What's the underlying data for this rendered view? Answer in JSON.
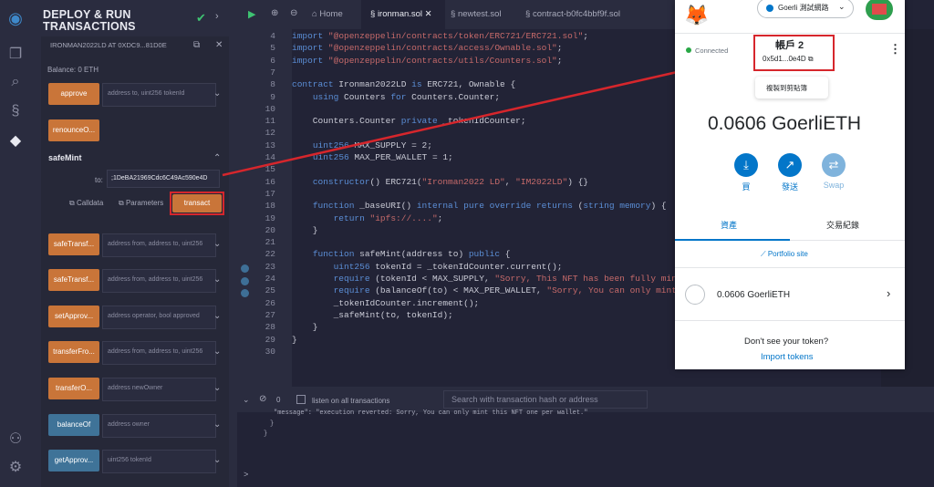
{
  "sidebar_icons": [
    "remix-logo-icon",
    "file-explorer-icon",
    "search-icon",
    "solidity-compiler-icon",
    "deploy-run-icon",
    "plugin-icon",
    "settings-icon"
  ],
  "panel": {
    "title": "DEPLOY & RUN TRANSACTIONS",
    "contract_instance": "IRONMAN2022LD AT 0XDC9...81D0E",
    "balance": "Balance: 0 ETH",
    "functions": [
      {
        "label": "approve",
        "placeholder": "address to, uint256 tokenId",
        "color": "orange"
      },
      {
        "label": "renounceO...",
        "placeholder": "",
        "color": "orange"
      },
      {
        "label": "safeTransf...",
        "placeholder": "address from, address to, uint256",
        "color": "orange"
      },
      {
        "label": "safeTransf...",
        "placeholder": "address from, address to, uint256",
        "color": "orange"
      },
      {
        "label": "setApprov...",
        "placeholder": "address operator, bool approved",
        "color": "orange"
      },
      {
        "label": "transferFro...",
        "placeholder": "address from, address to, uint256",
        "color": "orange"
      },
      {
        "label": "transferO...",
        "placeholder": "address newOwner",
        "color": "orange"
      },
      {
        "label": "balanceOf",
        "placeholder": "address owner",
        "color": "blue"
      },
      {
        "label": "getApprov...",
        "placeholder": "uint256 tokenId",
        "color": "blue"
      }
    ],
    "safe_mint": {
      "title": "safeMint",
      "to_label": "to:",
      "to_value": ";1DeBA21969Cdc6C49Ac590e4D",
      "calldata": "Calldata",
      "parameters": "Parameters",
      "transact": "transact"
    }
  },
  "tabs": [
    "Home",
    "ironman.sol",
    "newtest.sol",
    "contract-b0fc4bbf9f.sol"
  ],
  "code": {
    "lines": [
      {
        "n": "4",
        "t": "import \"@openzeppelin/contracts/token/ERC721/ERC721.sol\";"
      },
      {
        "n": "5",
        "t": "import \"@openzeppelin/contracts/access/Ownable.sol\";"
      },
      {
        "n": "6",
        "t": "import \"@openzeppelin/contracts/utils/Counters.sol\";"
      },
      {
        "n": "7",
        "t": ""
      },
      {
        "n": "8",
        "t": "contract Ironman2022LD is ERC721, Ownable {"
      },
      {
        "n": "9",
        "t": "    using Counters for Counters.Counter;"
      },
      {
        "n": "10",
        "t": ""
      },
      {
        "n": "11",
        "t": "    Counters.Counter private _tokenIdCounter;"
      },
      {
        "n": "12",
        "t": ""
      },
      {
        "n": "13",
        "t": "    uint256 MAX_SUPPLY = 2;"
      },
      {
        "n": "14",
        "t": "    uint256 MAX_PER_WALLET = 1;"
      },
      {
        "n": "15",
        "t": ""
      },
      {
        "n": "16",
        "t": "    constructor() ERC721(\"Ironman2022 LD\", \"IM2022LD\") {}"
      },
      {
        "n": "17",
        "t": ""
      },
      {
        "n": "18",
        "t": "    function _baseURI() internal pure override returns (string memory) {"
      },
      {
        "n": "19",
        "t": "        return \"ipfs://....\";"
      },
      {
        "n": "20",
        "t": "    }"
      },
      {
        "n": "21",
        "t": ""
      },
      {
        "n": "22",
        "t": "    function safeMint(address to) public {"
      },
      {
        "n": "23",
        "t": "        uint256 tokenId = _tokenIdCounter.current();"
      },
      {
        "n": "24",
        "t": "        require (tokenId < MAX_SUPPLY, \"Sorry, This NFT has been fully minted"
      },
      {
        "n": "25",
        "t": "        require (balanceOf(to) < MAX_PER_WALLET, \"Sorry, You can only mint thi"
      },
      {
        "n": "26",
        "t": "        _tokenIdCounter.increment();"
      },
      {
        "n": "27",
        "t": "        _safeMint(to, tokenId);"
      },
      {
        "n": "28",
        "t": "    }"
      },
      {
        "n": "29",
        "t": "}"
      },
      {
        "n": "30",
        "t": ""
      }
    ]
  },
  "terminal": {
    "count": "0",
    "listen_label": "listen on all transactions",
    "search_placeholder": "Search with transaction hash or address",
    "out1": "\"message\": \"execution reverted: Sorry, You can only mint this NFT one per wallet.\"",
    "out2": "}",
    "out3": "}",
    "prompt": ">"
  },
  "metamask": {
    "network": "Goerli 測試網路",
    "connected": "Connected",
    "account_name": "帳戶 2",
    "account_addr": "0x5d1...0e4D",
    "tooltip": "複製到剪貼簿",
    "balance": "0.0606 GoerliETH",
    "actions": [
      "買",
      "發送",
      "Swap"
    ],
    "tab_assets": "資產",
    "tab_activity": "交易紀錄",
    "portfolio": "Portfolio site",
    "token_balance": "0.0606 GoerliETH",
    "dont_see": "Don't see your token?",
    "import_tokens": "Import tokens"
  },
  "colors": {
    "accent": "#0376c9",
    "orange": "#c97539",
    "blue": "#3f7398",
    "annotation": "#d6262c",
    "green": "#3ec372"
  }
}
